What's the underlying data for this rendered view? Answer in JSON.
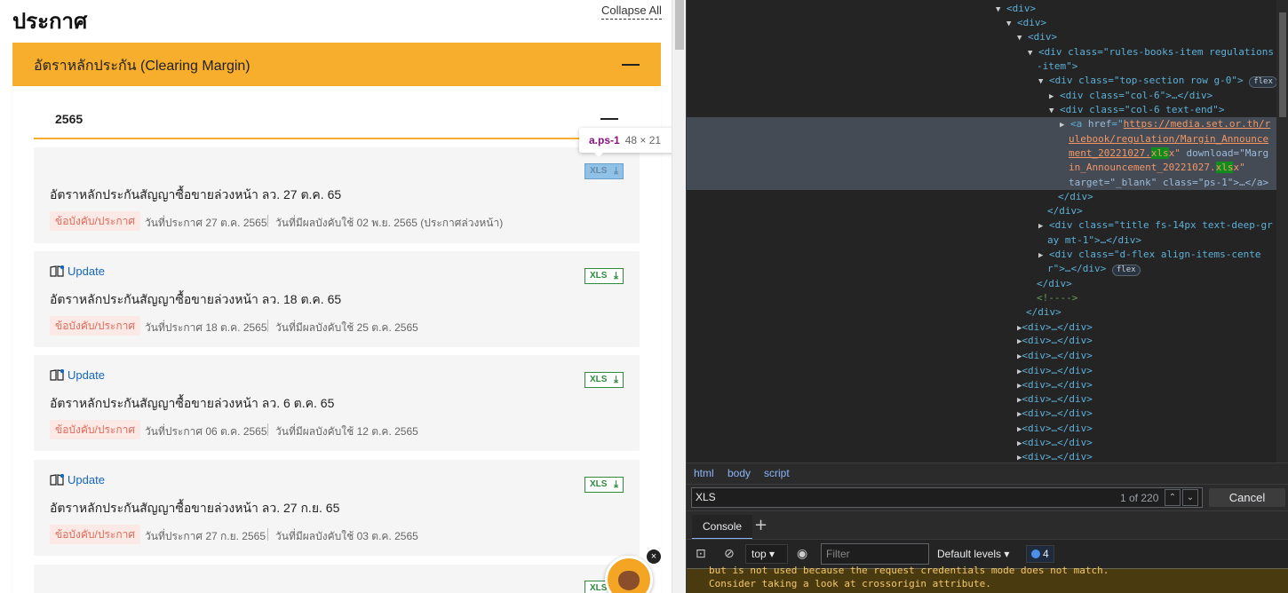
{
  "page": {
    "title": "ประกาศ",
    "collapse_all": "Collapse All",
    "accordion_title": "อัตราหลักประกัน (Clearing Margin)",
    "year": "2565",
    "update_label": "Update",
    "xls_label": "XLS",
    "download_glyph": "⤓",
    "cards": [
      {
        "title": "อัตราหลักประกันสัญญาซื้อขายล่วงหน้า ลว. 27 ต.ค. 65",
        "tag": "ข้อบังคับ/ประกาศ",
        "announce": "วันที่ประกาศ 27 ต.ค. 2565",
        "effective": "วันที่มีผลบังคับใช้ 02 พ.ย. 2565 (ประกาศล่วงหน้า)",
        "has_update": false
      },
      {
        "title": "อัตราหลักประกันสัญญาซื้อขายล่วงหน้า ลว. 18 ต.ค. 65",
        "tag": "ข้อบังคับ/ประกาศ",
        "announce": "วันที่ประกาศ 18 ต.ค. 2565",
        "effective": "วันที่มีผลบังคับใช้ 25 ต.ค. 2565",
        "has_update": true
      },
      {
        "title": "อัตราหลักประกันสัญญาซื้อขายล่วงหน้า ลว. 6 ต.ค. 65",
        "tag": "ข้อบังคับ/ประกาศ",
        "announce": "วันที่ประกาศ 06 ต.ค. 2565",
        "effective": "วันที่มีผลบังคับใช้ 12 ต.ค. 2565",
        "has_update": true
      },
      {
        "title": "อัตราหลักประกันสัญญาซื้อขายล่วงหน้า ลว. 27 ก.ย. 65",
        "tag": "ข้อบังคับ/ประกาศ",
        "announce": "วันที่ประกาศ 27 ก.ย. 2565",
        "effective": "วันที่มีผลบังคับใช้ 03 ต.ค. 2565",
        "has_update": true
      }
    ],
    "tooltip": {
      "selector": "a.ps-1",
      "size": "48 × 21"
    },
    "mascot_close": "×"
  },
  "devtools": {
    "breadcrumbs": [
      "html",
      "body",
      "script"
    ],
    "search_value": "XLS",
    "search_count": "1 of 220",
    "cancel_label": "Cancel",
    "drawer_tab": "Console",
    "context": "top",
    "filter_placeholder": "Filter",
    "levels": "Default levels",
    "issues_count": "4",
    "console_lines": [
      "but is not used because the request credentials mode does not match.",
      "Consider taking a look at crossorigin attribute."
    ],
    "dom": {
      "div_open": "<div>",
      "rules_item_1": "<div class=\"rules-books-item regulations",
      "rules_item_2": "-item\">",
      "top_section": "<div class=\"top-section row g-0\">",
      "col6": "<div class=\"col-6\">…</div>",
      "col6_end": "<div class=\"col-6 text-end\">",
      "a_href_1": "https://media.set.or.th/r",
      "a_href_2": "ulebook/regulation/Margin_Announce",
      "a_href_3a": "ment_20221027.",
      "a_hl": "xls",
      "a_href_3b": "x\"",
      "a_download": " download=\"Marg",
      "a_download_2a": "in_Announcement_20221027.",
      "a_download_2b": "x\"",
      "a_target": "target=\"_blank\" class=\"ps-1\">…</a>",
      "div_close": "</div>",
      "title_div_1": "<div class=\"title fs-14px text-deep-gr",
      "title_div_2": "ay mt-1\">…</div>",
      "dflex_1": "<div class=\"d-flex align-items-cente",
      "dflex_2": "r\">…</div>",
      "comment": "<!---->",
      "collapsed_div": "<div>…</div>",
      "flex_badge": "flex"
    }
  }
}
